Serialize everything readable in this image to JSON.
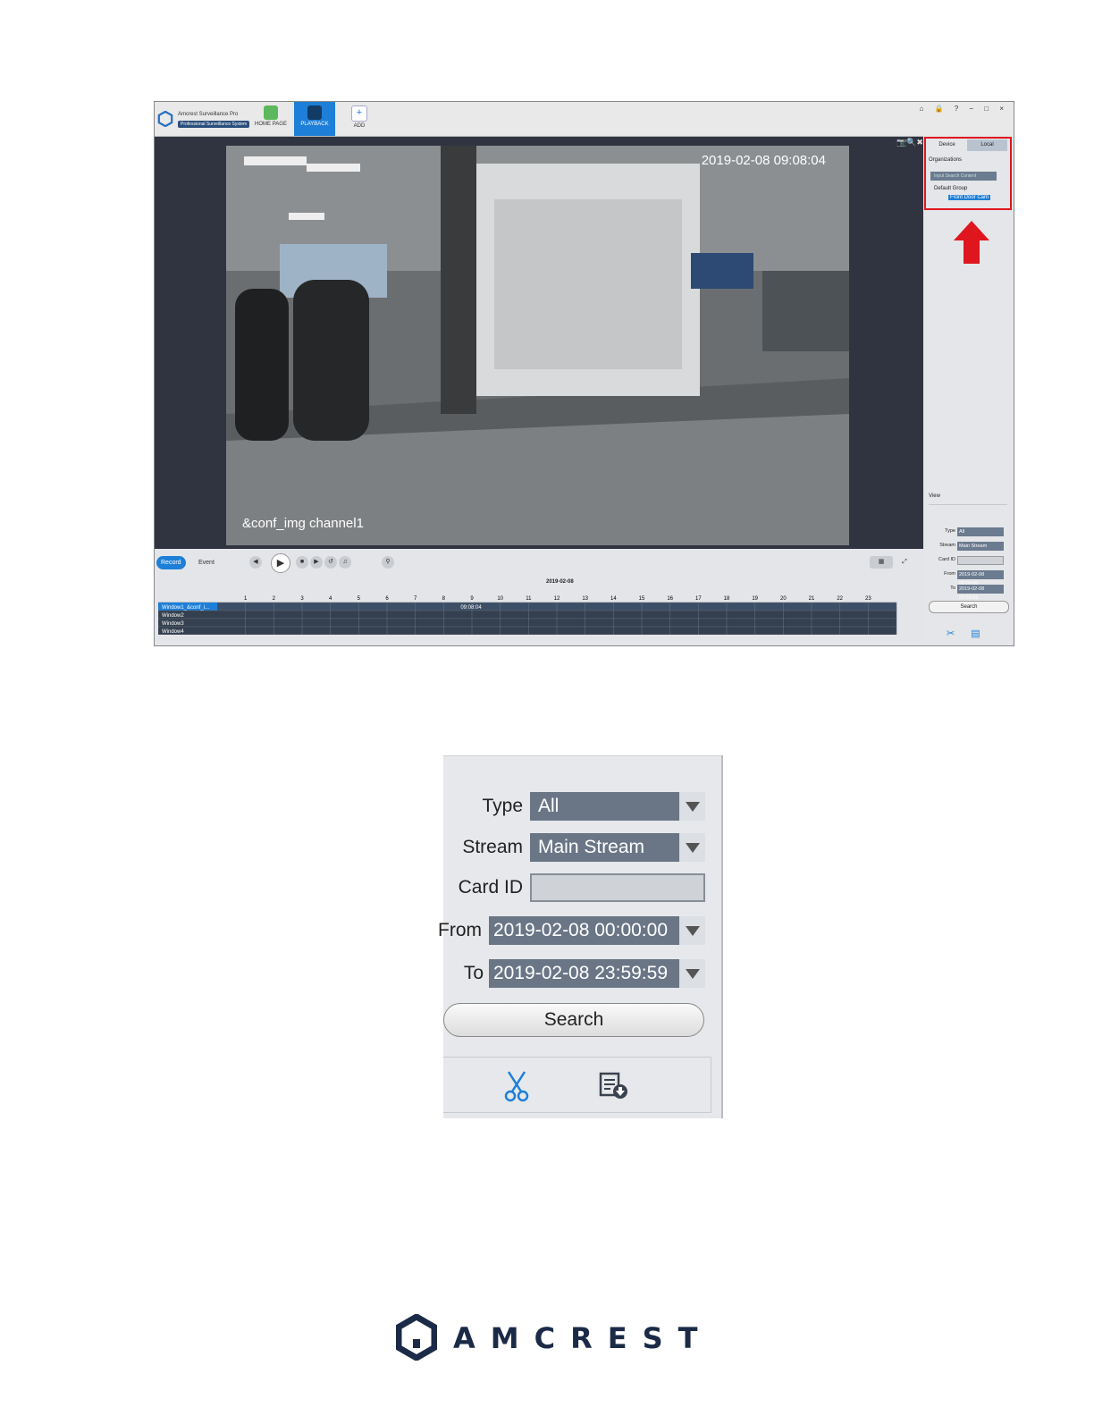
{
  "app": {
    "brand_title": "Amcrest Surveillance Pro",
    "brand_subtitle": "Professional Surveillance System",
    "nav": [
      {
        "label": "HOME PAGE"
      },
      {
        "label": "PLAYBACK"
      },
      {
        "label": "ADD"
      }
    ],
    "window_controls": "⌂ 🔒 ? − □ ×",
    "video": {
      "timestamp": "2019-02-08 09:08:04",
      "channel_label": "&conf_img channel1",
      "toolbar_icons": "📷🔍✖"
    },
    "controls": {
      "record_label": "Record",
      "event_label": "Event"
    },
    "timeline": {
      "date": "2019-02-08",
      "hours": [
        "1",
        "2",
        "3",
        "4",
        "5",
        "6",
        "7",
        "8",
        "9",
        "10",
        "11",
        "12",
        "13",
        "14",
        "15",
        "16",
        "17",
        "18",
        "19",
        "20",
        "21",
        "22",
        "23"
      ],
      "windows": [
        "Window1_&conf_i...",
        "Window2",
        "Window3",
        "Window4"
      ],
      "record_marker": "09:08:04",
      "record_hour": 9.1
    },
    "side": {
      "tab_device": "Device",
      "tab_local": "Local",
      "org_label": "Organizations",
      "search_placeholder": "Input Search Content",
      "tree_group": "Default Group",
      "tree_device": "Front Door Cam",
      "view_label": "View",
      "type_label": "Type",
      "type_value": "All",
      "stream_label": "Stream",
      "stream_value": "Main Stream",
      "card_label": "Card ID",
      "from_label": "From",
      "from_value": "2019-02-08 00:00:00",
      "to_label": "To",
      "to_value": "2019-02-08 23:59:59",
      "search_label": "Search"
    }
  },
  "search_panel": {
    "type_label": "Type",
    "type_value": "All",
    "stream_label": "Stream",
    "stream_value": "Main Stream",
    "card_label": "Card ID",
    "card_value": "",
    "from_label": "From",
    "from_value": "2019-02-08 00:00:00",
    "to_label": "To",
    "to_value": "2019-02-08 23:59:59",
    "search_button": "Search"
  },
  "brand": {
    "wordmark": "AMCREST",
    "color": "#1b2a47"
  },
  "colors": {
    "accent": "#1d7fd8",
    "highlight": "#e0161e",
    "field": "#6a7686"
  }
}
